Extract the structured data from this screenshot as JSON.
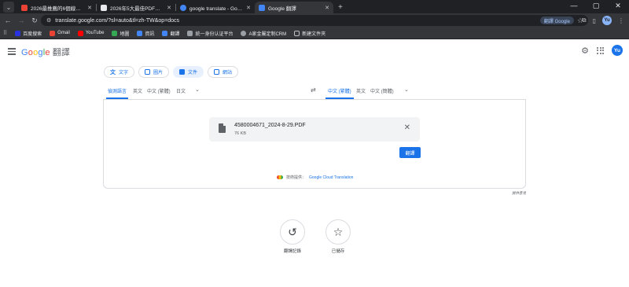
{
  "browser": {
    "tabs": [
      {
        "title": "2026最推薦的6個線上PDF翻譯...",
        "fav_color": "#ea4335"
      },
      {
        "title": "2026年5大最佳PDF翻譯網站比...",
        "fav_color": "#e8eaed"
      },
      {
        "title": "google translate - Google 搜...",
        "fav_color": "#4285f4"
      },
      {
        "title": "Google 翻譯",
        "fav_color": "#4285f4"
      }
    ],
    "url": "translate.google.com/?sl=auto&tl=zh-TW&op=docs",
    "google_pill": "翻譯 Google",
    "profile_initial": "Yu",
    "bookmarks": [
      {
        "label": "百度搜索",
        "color": "#2932e1"
      },
      {
        "label": "Gmail",
        "color": "#ea4335"
      },
      {
        "label": "YouTube",
        "color": "#ff0000"
      },
      {
        "label": "地圖",
        "color": "#34a853"
      },
      {
        "label": "資訊",
        "color": "#4285f4"
      },
      {
        "label": "翻譯",
        "color": "#4285f4"
      },
      {
        "label": "統一身份认证平台",
        "color": "#9aa0a6"
      },
      {
        "label": "A家金屬定制CRM",
        "color": "#9aa0a6"
      },
      {
        "label": "新建文件夾",
        "color": "#fdd663"
      }
    ]
  },
  "header": {
    "logo_google": [
      "G",
      "o",
      "o",
      "g",
      "l",
      "e"
    ],
    "logo_service": "翻譯",
    "account_initial": "Yu"
  },
  "modes": [
    {
      "label": "文字",
      "active": false
    },
    {
      "label": "圖片",
      "active": false
    },
    {
      "label": "文件",
      "active": true
    },
    {
      "label": "網站",
      "active": false
    }
  ],
  "source_langs": [
    "偵測語言",
    "英文",
    "中文 (繁體)",
    "日文"
  ],
  "target_langs": [
    "中文 (繁體)",
    "英文",
    "中文 (簡體)"
  ],
  "file": {
    "name": "4580004671_2024-8-29.PDF",
    "size": "76 KB"
  },
  "translate_button": "翻譯",
  "powered_by": {
    "prefix": "技術提供：",
    "link": "Google Cloud Translation"
  },
  "feedback": "提供意見",
  "actions": [
    {
      "label": "翻譯記錄",
      "icon": "history-icon"
    },
    {
      "label": "已儲存",
      "icon": "star-icon"
    }
  ]
}
